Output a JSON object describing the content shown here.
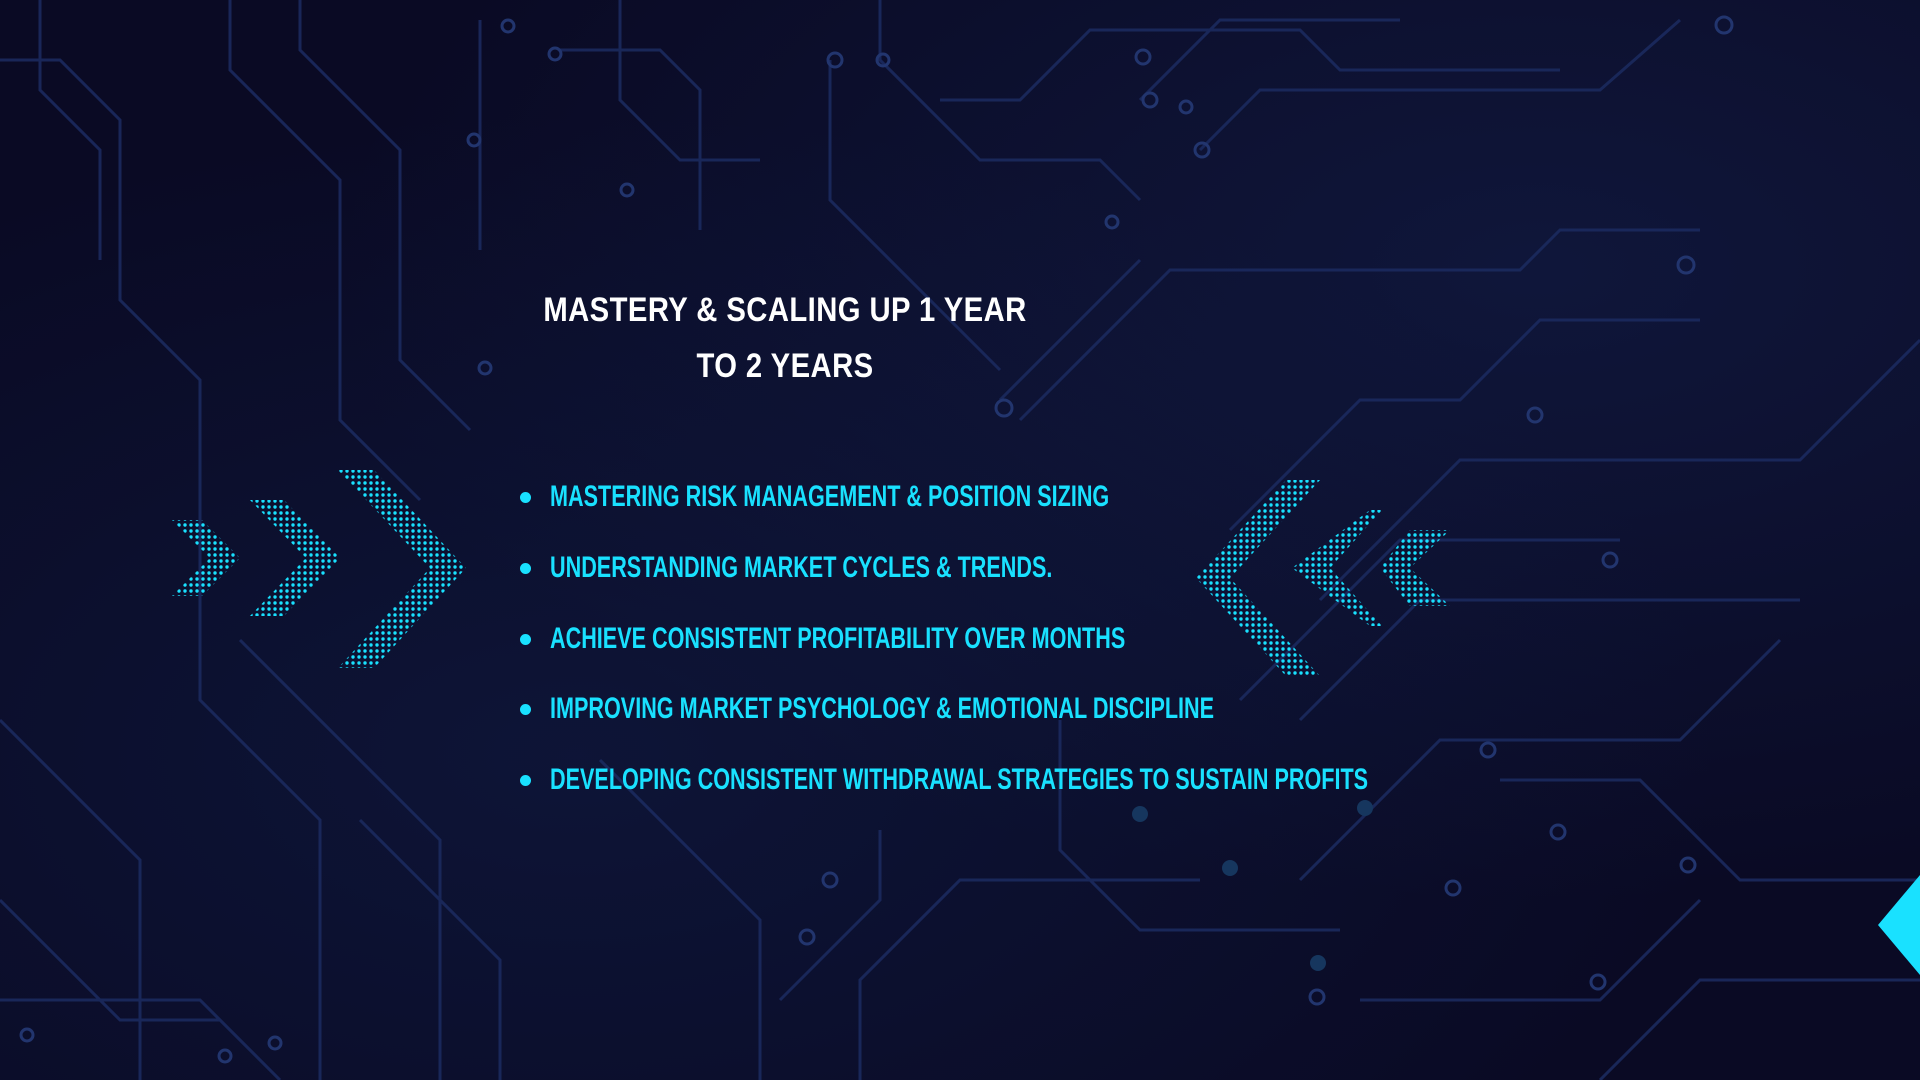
{
  "slide": {
    "title": "MASTERY & SCALING UP 1 YEAR TO 2 YEARS",
    "bullets": [
      "MASTERING RISK MANAGEMENT & POSITION SIZING",
      "UNDERSTANDING MARKET CYCLES & TRENDS.",
      "ACHIEVE CONSISTENT PROFITABILITY OVER MONTHS",
      "IMPROVING MARKET PSYCHOLOGY & EMOTIONAL DISCIPLINE",
      "DEVELOPING CONSISTENT WITHDRAWAL STRATEGIES TO SUSTAIN PROFITS"
    ]
  },
  "colors": {
    "background": "#0a0a24",
    "accent": "#19e1ff",
    "title": "#ffffff",
    "circuit": "#1b2a5e"
  },
  "decorations": {
    "left_arrows": "dotted-chevrons-right",
    "right_arrows": "dotted-chevrons-left",
    "corner": "cyan-triangle"
  }
}
